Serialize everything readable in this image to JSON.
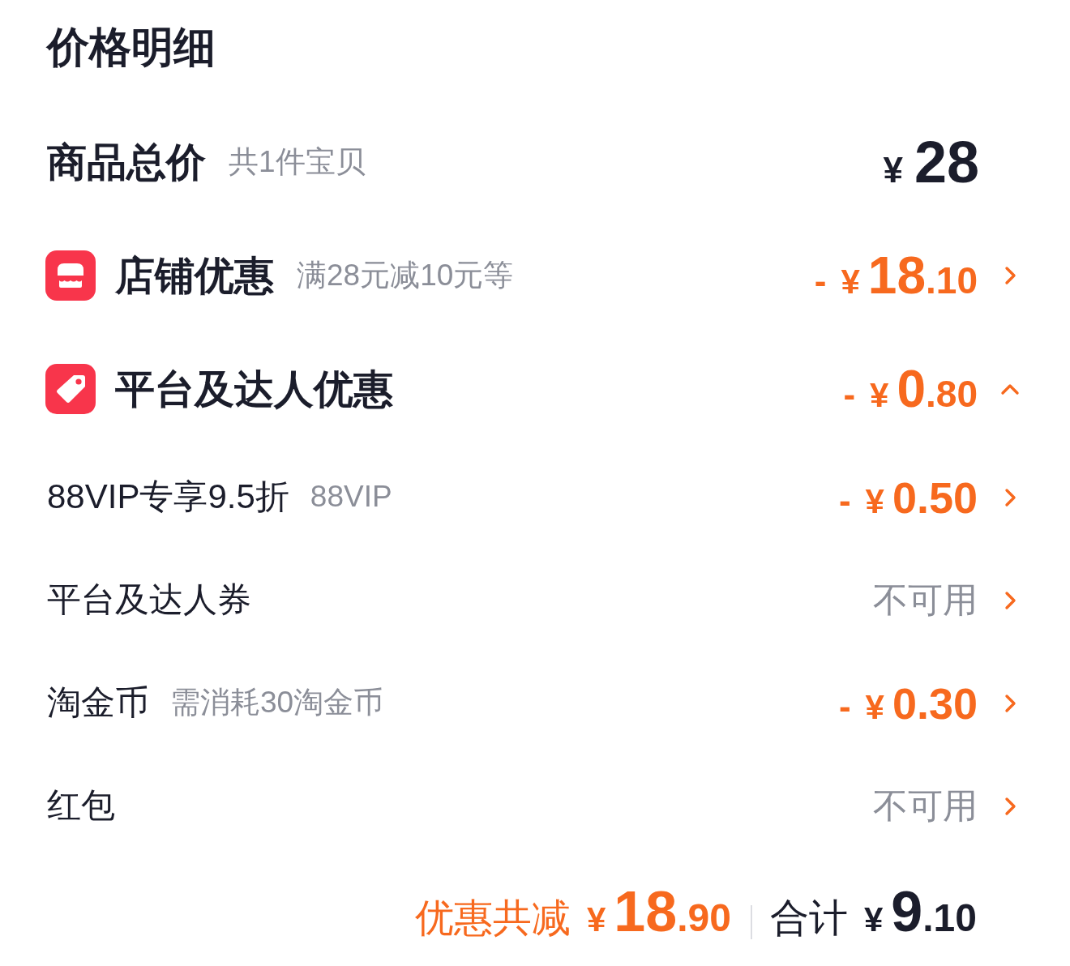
{
  "title": "价格明细",
  "rows": [
    {
      "kind": "total",
      "label": "商品总价",
      "note": "共1件宝贝",
      "amount": {
        "currency": "¥",
        "main": "28"
      }
    },
    {
      "kind": "store_discount",
      "label": "店铺优惠",
      "note": "满28元减10元等",
      "amount": {
        "sign": "-",
        "currency": "¥",
        "main": "18",
        "small": ".10"
      },
      "expanded": false
    },
    {
      "kind": "platform_discount",
      "label": "平台及达人优惠",
      "amount": {
        "sign": "-",
        "currency": "¥",
        "main": "0",
        "small": ".80"
      },
      "expanded": true,
      "children": [
        {
          "kind": "discount",
          "label": "88VIP专享9.5折",
          "note": "88VIP",
          "amount": {
            "sign": "-",
            "currency": "¥",
            "main": "0.50"
          }
        },
        {
          "kind": "unavailable",
          "label": "平台及达人券",
          "status": "不可用"
        },
        {
          "kind": "discount",
          "label": "淘金币",
          "note": "需消耗30淘金币",
          "amount": {
            "sign": "-",
            "currency": "¥",
            "main": "0.30"
          }
        },
        {
          "kind": "unavailable",
          "label": "红包",
          "status": "不可用"
        }
      ]
    }
  ],
  "summary": {
    "discount_label": "优惠共减",
    "discount": {
      "currency": "¥",
      "main": "18",
      "small": ".90"
    },
    "total_label": "合计",
    "total": {
      "currency": "¥",
      "main": "9",
      "small": ".10"
    }
  }
}
